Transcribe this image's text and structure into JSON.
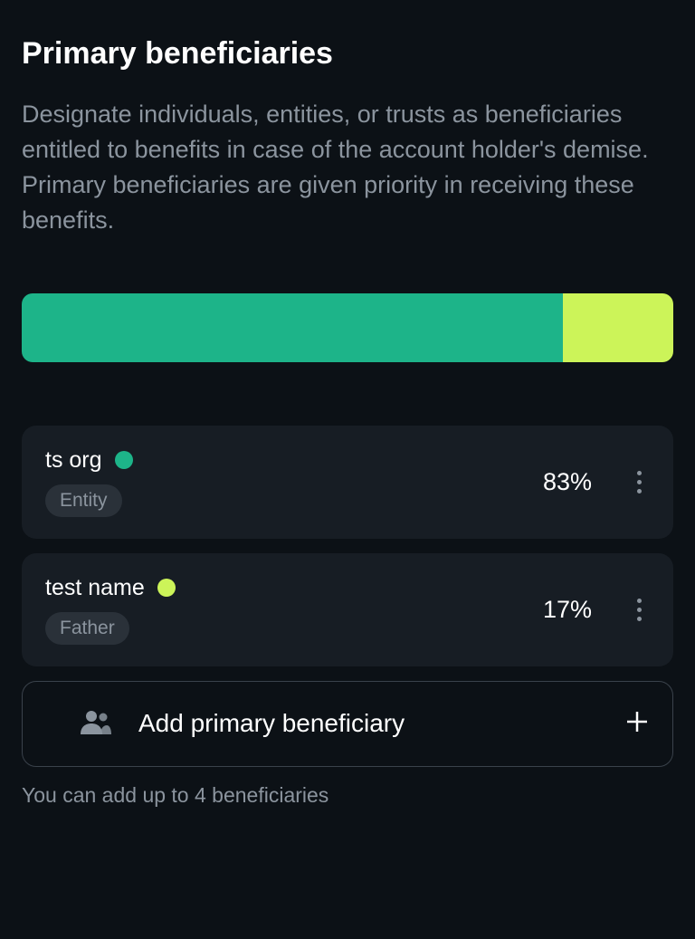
{
  "header": {
    "title": "Primary beneficiaries",
    "description": "Designate individuals, entities, or trusts as beneficiaries entitled to benefits in case of the account holder's demise. Primary beneficiaries are given priority in receiving these benefits."
  },
  "progress": {
    "segment1_width": "83%"
  },
  "beneficiaries": [
    {
      "name": "ts org",
      "tag": "Entity",
      "percent": "83%",
      "dot_color": "teal"
    },
    {
      "name": "test name",
      "tag": "Father",
      "percent": "17%",
      "dot_color": "lime"
    }
  ],
  "add_button": {
    "label": "Add primary beneficiary"
  },
  "footer": {
    "note": "You can add up to 4 beneficiaries"
  }
}
